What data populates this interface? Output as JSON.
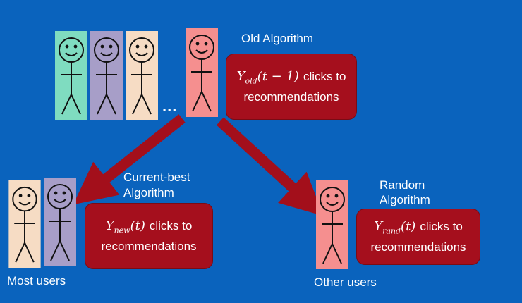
{
  "colors": {
    "background": "#0a63bd",
    "box": "#a50f1d",
    "arrow": "#a30f1b",
    "card_teal": "#7fdcc0",
    "card_lavender": "#a79ec8",
    "card_peach": "#f6dcc4",
    "card_pink": "#f58f8f"
  },
  "top_group": {
    "cards": [
      "card_teal",
      "card_lavender",
      "card_peach"
    ],
    "ellipsis": "...",
    "highlight_card": "card_pink"
  },
  "old": {
    "label": "Old Algorithm",
    "var": "Y",
    "sub": "old",
    "arg": "(t − 1)",
    "text": "clicks to",
    "line2": "recommendations"
  },
  "left_group": {
    "cards": [
      "card_peach",
      "card_lavender"
    ],
    "caption": "Most users"
  },
  "current": {
    "label_line1": "Current-best",
    "label_line2": "Algorithm",
    "var": "Y",
    "sub": "new",
    "arg": "(t)",
    "text": "clicks to",
    "line2": "recommendations"
  },
  "right_group": {
    "cards": [
      "card_pink"
    ],
    "caption": "Other users"
  },
  "random": {
    "label_line1": "Random",
    "label_line2": "Algorithm",
    "var": "Y",
    "sub": "rand",
    "arg": "(t)",
    "text": "clicks to",
    "line2": "recommendations"
  }
}
